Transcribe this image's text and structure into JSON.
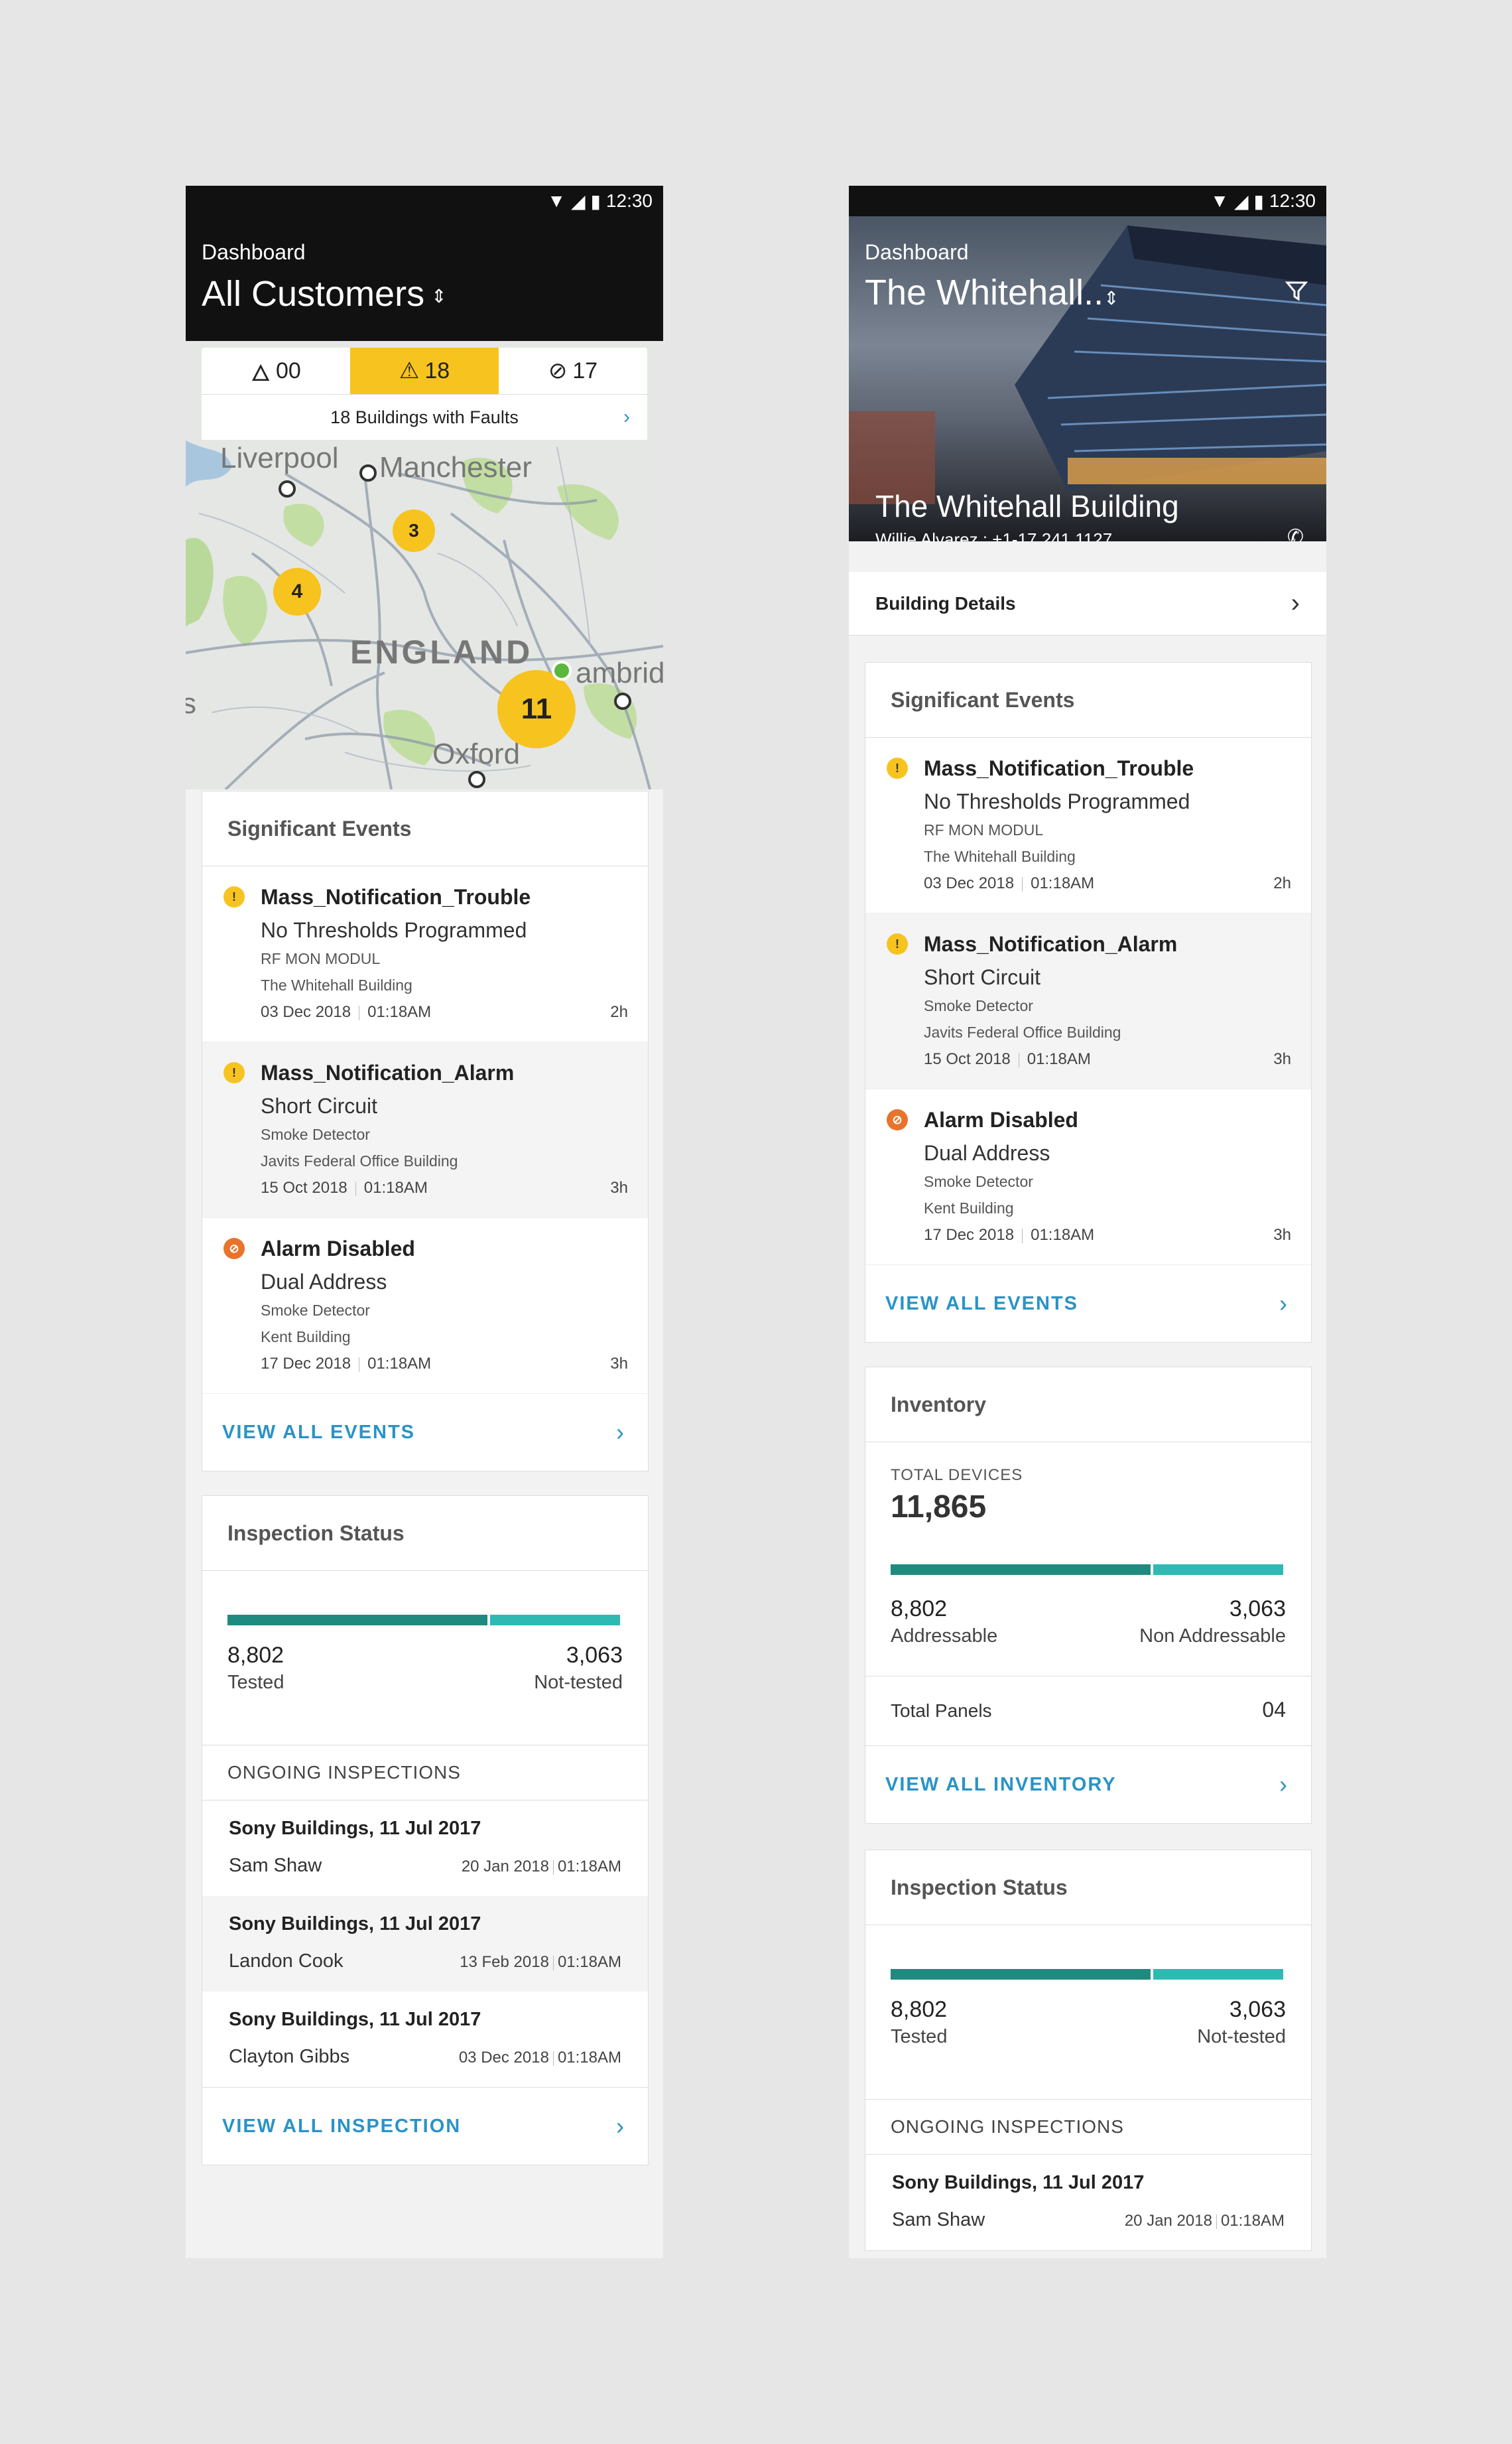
{
  "status_time": "12:30",
  "left": {
    "header_sub": "Dashboard",
    "header_title": "All Customers",
    "counts": {
      "fire": "00",
      "fault": "18",
      "disabled": "17"
    },
    "fault_banner": "18 Buildings with Faults",
    "map_labels": {
      "liverpool": "Liverpool",
      "manchester": "Manchester",
      "england": "ENGLAND",
      "cambridge": "ambrid",
      "oxford": "Oxford",
      "s": "s"
    },
    "clusters": {
      "c3": "3",
      "c4": "4",
      "c11": "11"
    },
    "events_title": "Significant Events",
    "events": [
      {
        "title": "Mass_Notification_Trouble",
        "desc": "No Thresholds Programmed",
        "device": "RF MON MODUL",
        "building": "The Whitehall Building",
        "date": "03 Dec 2018",
        "time": "01:18AM",
        "age": "2h",
        "icon": "warning-icon"
      },
      {
        "title": "Mass_Notification_Alarm",
        "desc": "Short Circuit",
        "device": "Smoke Detector",
        "building": "Javits Federal Office Building",
        "date": "15 Oct 2018",
        "time": "01:18AM",
        "age": "3h",
        "icon": "warning-icon"
      },
      {
        "title": "Alarm Disabled",
        "desc": "Dual Address",
        "device": "Smoke Detector",
        "building": "Kent Building",
        "date": "17 Dec 2018",
        "time": "01:18AM",
        "age": "3h",
        "icon": "disabled-icon"
      }
    ],
    "view_all_events": "VIEW ALL EVENTS",
    "inspection_title": "Inspection Status",
    "tested": "8,802",
    "tested_label": "Tested",
    "not_tested": "3,063",
    "not_tested_label": "Not-tested",
    "ongoing_label": "ONGOING INSPECTIONS",
    "inspections": [
      {
        "title": "Sony Buildings, 11 Jul 2017",
        "person": "Sam Shaw",
        "date": "20 Jan 2018",
        "time": "01:18AM"
      },
      {
        "title": "Sony Buildings, 11 Jul 2017",
        "person": "Landon Cook",
        "date": "13 Feb 2018",
        "time": "01:18AM"
      },
      {
        "title": "Sony Buildings, 11 Jul 2017",
        "person": "Clayton Gibbs",
        "date": "03 Dec 2018",
        "time": "01:18AM"
      }
    ],
    "view_all_inspection": "VIEW ALL INSPECTION"
  },
  "right": {
    "header_sub": "Dashboard",
    "header_title": "The Whitehall..",
    "building_name": "The Whitehall Building",
    "contact": "Willie Alvarez : +1-17 241 1127",
    "building_details": "Building Details",
    "events_title": "Significant Events",
    "events": [
      {
        "title": "Mass_Notification_Trouble",
        "desc": "No Thresholds Programmed",
        "device": "RF MON MODUL",
        "building": "The Whitehall Building",
        "date": "03 Dec 2018",
        "time": "01:18AM",
        "age": "2h",
        "icon": "warning-icon"
      },
      {
        "title": "Mass_Notification_Alarm",
        "desc": "Short Circuit",
        "device": "Smoke Detector",
        "building": "Javits Federal Office Building",
        "date": "15 Oct 2018",
        "time": "01:18AM",
        "age": "3h",
        "icon": "warning-icon"
      },
      {
        "title": "Alarm Disabled",
        "desc": "Dual Address",
        "device": "Smoke Detector",
        "building": "Kent Building",
        "date": "17 Dec 2018",
        "time": "01:18AM",
        "age": "3h",
        "icon": "disabled-icon"
      }
    ],
    "view_all_events": "VIEW ALL EVENTS",
    "inventory_title": "Inventory",
    "total_devices_label": "TOTAL DEVICES",
    "total_devices": "11,865",
    "addressable": "8,802",
    "addressable_label": "Addressable",
    "non_addressable": "3,063",
    "non_addressable_label": "Non Addressable",
    "total_panels_label": "Total Panels",
    "total_panels": "04",
    "view_all_inventory": "VIEW ALL INVENTORY",
    "inspection_title": "Inspection Status",
    "tested": "8,802",
    "tested_label": "Tested",
    "not_tested": "3,063",
    "not_tested_label": "Not-tested",
    "ongoing_label": "ONGOING INSPECTIONS",
    "inspections": [
      {
        "title": "Sony Buildings, 11 Jul 2017",
        "person": "Sam Shaw",
        "date": "20 Jan 2018",
        "time": "01:18AM"
      }
    ]
  },
  "colors": {
    "accent": "#2a93c6",
    "warning": "#f7c31e",
    "disabled": "#e8742c",
    "tested_bar": "#1f8a7f",
    "not_tested_bar": "#2fb9b3"
  }
}
